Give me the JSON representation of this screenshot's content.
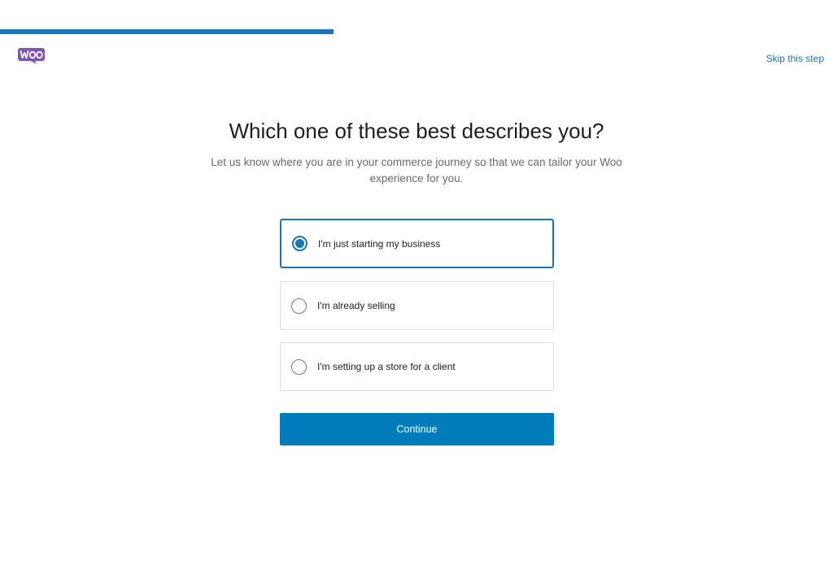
{
  "progress": {
    "fraction": 0.4
  },
  "header": {
    "logo_text": "Woo",
    "skip_label": "Skip this step"
  },
  "main": {
    "title": "Which one of these best describes you?",
    "subtitle": "Let us know where you are in your commerce journey so that we can tailor your Woo experience for you.",
    "options": [
      {
        "label": "I'm just starting my business",
        "selected": true
      },
      {
        "label": "I'm already selling",
        "selected": false
      },
      {
        "label": "I'm setting up a store for a client",
        "selected": false
      }
    ],
    "continue_label": "Continue"
  },
  "colors": {
    "accent": "#007cba",
    "brand": "#7f54b3"
  }
}
